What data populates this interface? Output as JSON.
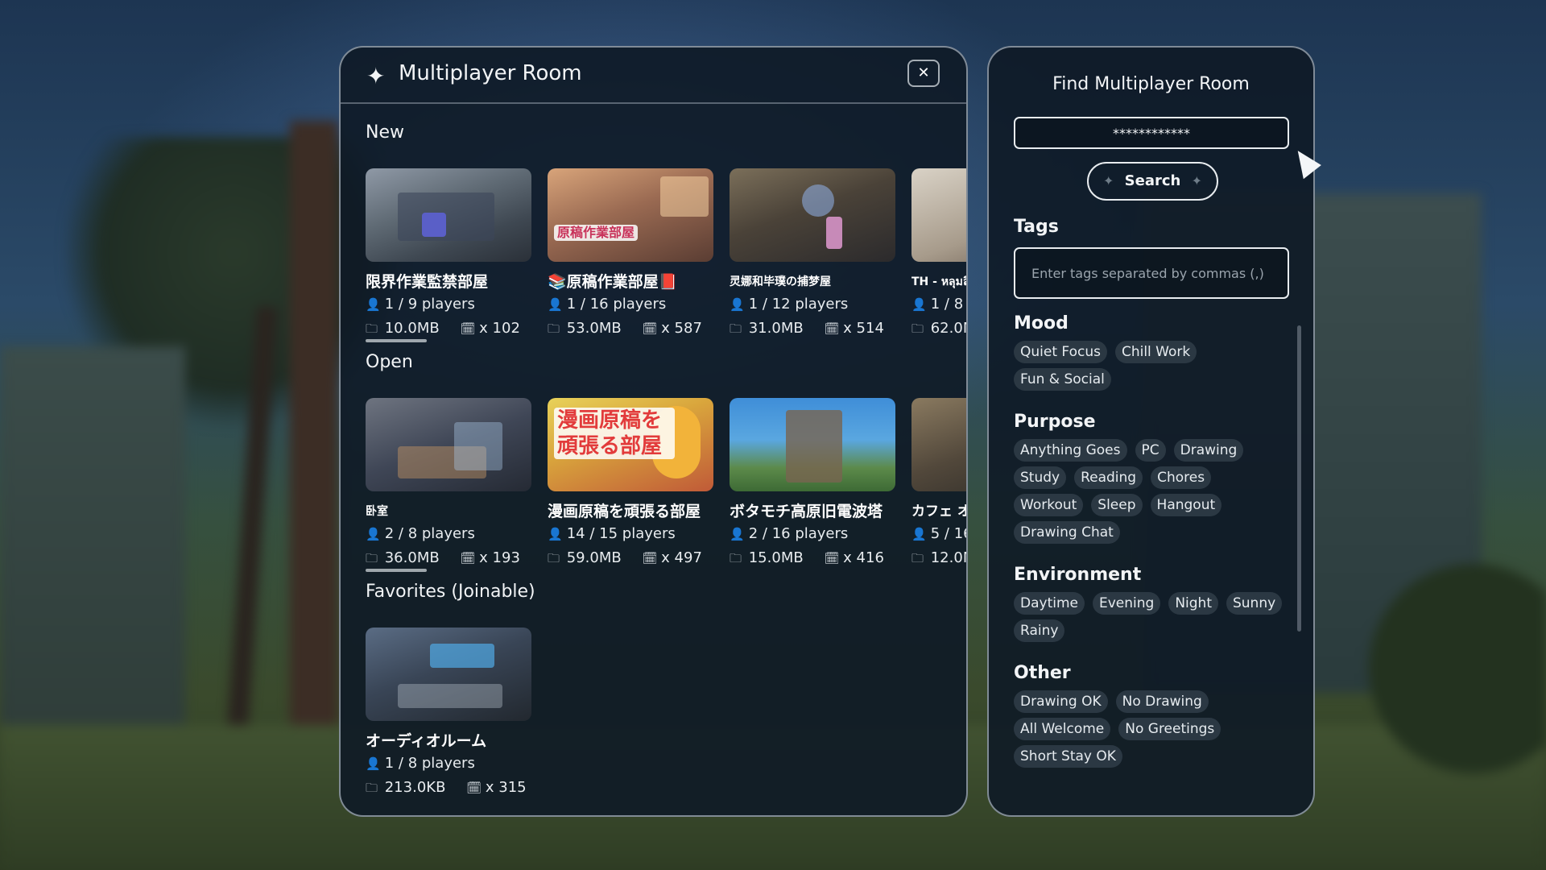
{
  "room_panel": {
    "title": "Multiplayer Room",
    "close_label": "✕",
    "sections": [
      {
        "title": "New",
        "cards": [
          {
            "name": "限界作業監禁部屋",
            "players": "1 / 9 players",
            "size": "10.0MB",
            "count": "x 102"
          },
          {
            "name": "📚原稿作業部屋📕",
            "players": "1 / 16 players",
            "size": "53.0MB",
            "count": "x 587",
            "thumb_text": "原稿作業部屋"
          },
          {
            "name": "灵娜和毕璞の捕梦屋",
            "players": "1 / 12 players",
            "size": "31.0MB",
            "count": "x 514"
          },
          {
            "name": "TH - หลุมลึ",
            "players": "1 / 8",
            "size": "62.0M",
            "count": ""
          }
        ]
      },
      {
        "title": "Open",
        "cards": [
          {
            "name": "卧室",
            "players": "2 / 8 players",
            "size": "36.0MB",
            "count": "x 193"
          },
          {
            "name": "漫画原稿を頑張る部屋",
            "players": "14 / 15 players",
            "size": "59.0MB",
            "count": "x 497",
            "thumb_text": "漫画原稿を頑張る部屋"
          },
          {
            "name": "ボタモチ高原旧電波塔",
            "players": "2 / 16 players",
            "size": "15.0MB",
            "count": "x 416"
          },
          {
            "name": "カフェ オ",
            "players": "5 / 16",
            "size": "12.0M",
            "count": ""
          }
        ]
      },
      {
        "title": "Favorites (Joinable)",
        "cards": [
          {
            "name": "オーディオルーム",
            "players": "1 / 8 players",
            "size": "213.0KB",
            "count": "x 315"
          }
        ]
      }
    ]
  },
  "find_panel": {
    "title": "Find Multiplayer Room",
    "search_value": "************",
    "search_label": "Search",
    "tags_label": "Tags",
    "tags_placeholder": "Enter tags separated by commas (,)",
    "groups": [
      {
        "title": "Mood",
        "tags": [
          "Quiet Focus",
          "Chill Work",
          "Fun & Social"
        ]
      },
      {
        "title": "Purpose",
        "tags": [
          "Anything Goes",
          "PC",
          "Drawing",
          "Study",
          "Reading",
          "Chores",
          "Workout",
          "Sleep",
          "Hangout",
          "Drawing Chat"
        ]
      },
      {
        "title": "Environment",
        "tags": [
          "Daytime",
          "Evening",
          "Night",
          "Sunny",
          "Rainy"
        ]
      },
      {
        "title": "Other",
        "tags": [
          "Drawing OK",
          "No Drawing",
          "All Welcome",
          "No Greetings",
          "Short Stay OK"
        ]
      }
    ]
  },
  "icons": {
    "title": "sparkle-icon",
    "players": "person-icon",
    "size": "folder-icon",
    "count": "calendar-icon"
  }
}
